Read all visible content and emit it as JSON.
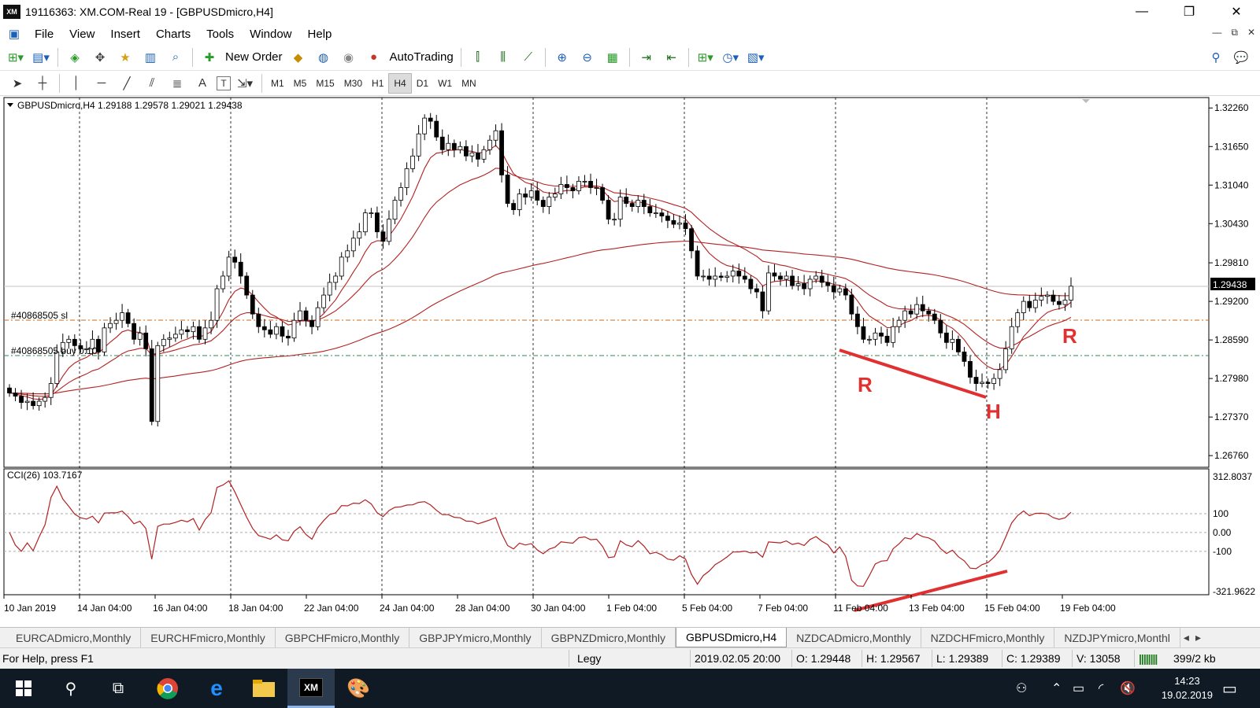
{
  "window": {
    "title": "19116363: XM.COM-Real 19 - [GBPUSDmicro,H4]",
    "logo": "XM",
    "minimize": "—",
    "maximize": "❐",
    "close": "✕"
  },
  "menu": [
    "File",
    "View",
    "Insert",
    "Charts",
    "Tools",
    "Window",
    "Help"
  ],
  "toolbar": {
    "new_order": "New Order",
    "autotrading": "AutoTrading"
  },
  "timeframes": [
    "M1",
    "M5",
    "M15",
    "M30",
    "H1",
    "H4",
    "D1",
    "W1",
    "MN"
  ],
  "active_timeframe": "H4",
  "drawing_tools": {
    "text_tool": "A",
    "label_tool": "T"
  },
  "chart": {
    "header": "GBPUSDmicro,H4  1.29188 1.29578 1.29021 1.29438",
    "price_ticks": [
      "1.32260",
      "1.31650",
      "1.31040",
      "1.30430",
      "1.29810",
      "1.29200",
      "1.28590",
      "1.27980",
      "1.27370",
      "1.26760"
    ],
    "current_price": "1.29438",
    "order_sl_label": "#40868505 sl",
    "order_buy_label": "#40868505 buy 0.10",
    "indicator_label": "CCI(26) 103.7167",
    "cci_ticks": [
      "312.8037",
      "100",
      "0.00",
      "-100",
      "-321.9622"
    ],
    "date_labels": [
      "10 Jan 2019",
      "14 Jan 04:00",
      "16 Jan 04:00",
      "18 Jan 04:00",
      "22 Jan 04:00",
      "24 Jan 04:00",
      "28 Jan 04:00",
      "30 Jan 04:00",
      "1 Feb 04:00",
      "5 Feb 04:00",
      "7 Feb 04:00",
      "11 Feb 04:00",
      "13 Feb 04:00",
      "15 Feb 04:00",
      "19 Feb 04:00"
    ],
    "annotations": {
      "left_r": "R",
      "h": "H",
      "right_r": "R"
    },
    "colors": {
      "ma": "#b22222",
      "cci": "#b22222",
      "annotation": "#e03030",
      "sl_line": "#d2691e",
      "buy_line": "#2e8b57"
    }
  },
  "chart_data": {
    "type": "candlestick",
    "title": "GBPUSDmicro,H4",
    "ylim": [
      1.266,
      1.324
    ],
    "close": [
      1.2775,
      1.277,
      1.276,
      1.2762,
      1.2755,
      1.2762,
      1.2768,
      1.279,
      1.284,
      1.2855,
      1.286,
      1.285,
      1.2845,
      1.2845,
      1.286,
      1.284,
      1.2878,
      1.2885,
      1.289,
      1.2902,
      1.2885,
      1.286,
      1.287,
      1.2845,
      1.273,
      1.285,
      1.286,
      1.2862,
      1.2868,
      1.2875,
      1.2872,
      1.288,
      1.286,
      1.2878,
      1.289,
      1.294,
      1.296,
      1.299,
      1.2982,
      1.296,
      1.293,
      1.29,
      1.288,
      1.2875,
      1.2868,
      1.288,
      1.2865,
      1.2862,
      1.289,
      1.2905,
      1.289,
      1.288,
      1.291,
      1.293,
      1.295,
      1.296,
      1.299,
      1.3,
      1.302,
      1.303,
      1.306,
      1.306,
      1.303,
      1.3015,
      1.305,
      1.308,
      1.31,
      1.313,
      1.315,
      1.3185,
      1.321,
      1.3205,
      1.318,
      1.316,
      1.317,
      1.316,
      1.3165,
      1.315,
      1.3155,
      1.3145,
      1.316,
      1.3175,
      1.319,
      1.312,
      1.3075,
      1.3065,
      1.309,
      1.3085,
      1.3095,
      1.308,
      1.307,
      1.3085,
      1.309,
      1.3105,
      1.31,
      1.3095,
      1.311,
      1.311,
      1.31,
      1.31,
      1.308,
      1.305,
      1.305,
      1.3085,
      1.3075,
      1.307,
      1.308,
      1.307,
      1.306,
      1.306,
      1.3055,
      1.3048,
      1.3042,
      1.3044,
      1.3035,
      1.3,
      1.296,
      1.296,
      1.2955,
      1.296,
      1.2958,
      1.296,
      1.2968,
      1.296,
      1.2955,
      1.294,
      1.2935,
      1.2905,
      1.2965,
      1.296,
      1.2955,
      1.296,
      1.2945,
      1.2948,
      1.294,
      1.2955,
      1.296,
      1.295,
      1.2945,
      1.2935,
      1.294,
      1.293,
      1.29,
      1.288,
      1.286,
      1.286,
      1.287,
      1.2865,
      1.2855,
      1.288,
      1.289,
      1.2905,
      1.29,
      1.2915,
      1.2905,
      1.29,
      1.289,
      1.287,
      1.2855,
      1.286,
      1.284,
      1.2825,
      1.28,
      1.279,
      1.2792,
      1.279,
      1.2798,
      1.2812,
      1.2845,
      1.288,
      1.2902,
      1.292,
      1.291,
      1.2922,
      1.2928,
      1.293,
      1.292,
      1.2915,
      1.2922,
      1.2944
    ]
  }
}
